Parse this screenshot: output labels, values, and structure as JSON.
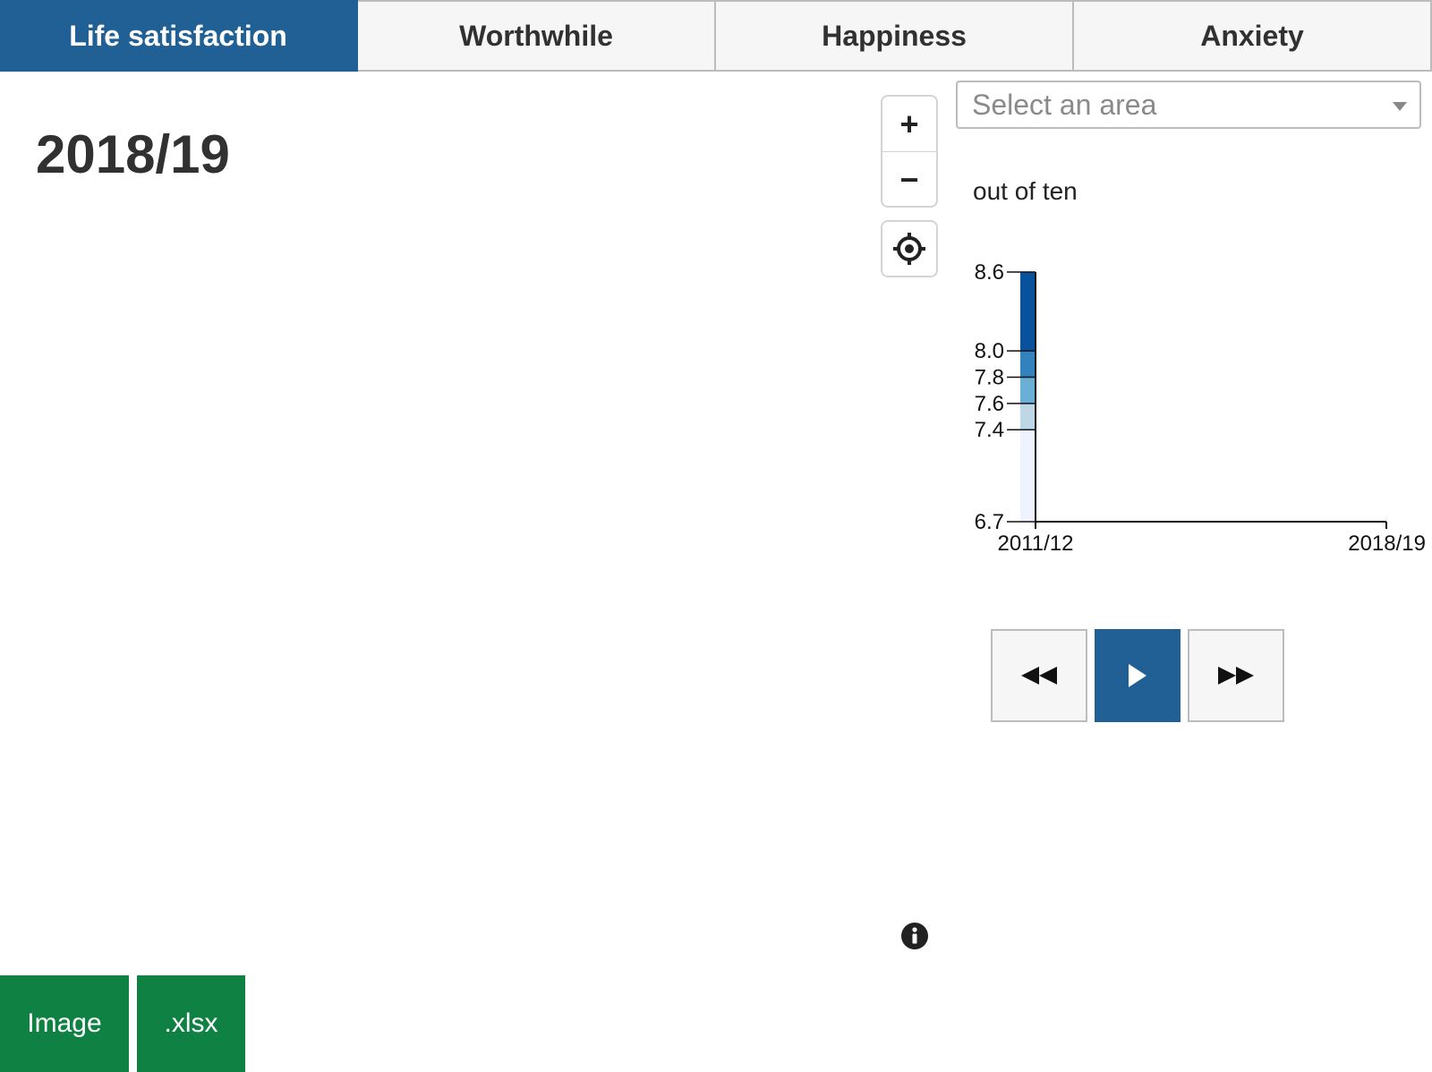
{
  "tabs": [
    {
      "label": "Life satisfaction",
      "active": true
    },
    {
      "label": "Worthwhile",
      "active": false
    },
    {
      "label": "Happiness",
      "active": false
    },
    {
      "label": "Anxiety",
      "active": false
    }
  ],
  "year": "2018/19",
  "map_controls": {
    "zoom_in": "+",
    "zoom_out": "−"
  },
  "area_select": {
    "placeholder": "Select an area"
  },
  "unit_label": "out of ten",
  "legend_colors": {
    "lowest": "#eff3ff",
    "low": "#bdd7e7",
    "mid": "#6baed6",
    "high": "#3182bd",
    "highest": "#08519c"
  },
  "chart_data": {
    "type": "bar",
    "description_role": "choropleth legend / time axis",
    "y_breaks": [
      6.7,
      7.4,
      7.6,
      7.8,
      8.0,
      8.6
    ],
    "ytick_labels": [
      "6.7",
      "7.4",
      "7.6",
      "7.8",
      "8.0",
      "8.6"
    ],
    "ylim": [
      6.7,
      8.6
    ],
    "xtick_labels": [
      "2011/12",
      "2018/19"
    ],
    "bins": [
      {
        "from": 6.7,
        "to": 7.4,
        "color": "#eff3ff"
      },
      {
        "from": 7.4,
        "to": 7.6,
        "color": "#bdd7e7"
      },
      {
        "from": 7.6,
        "to": 7.8,
        "color": "#6baed6"
      },
      {
        "from": 7.8,
        "to": 8.0,
        "color": "#3182bd"
      },
      {
        "from": 8.0,
        "to": 8.6,
        "color": "#08519c"
      }
    ]
  },
  "playback": {
    "accent": "#206095"
  },
  "downloads": {
    "image_label": "Image",
    "xlsx_label": ".xlsx"
  },
  "brand_colors": {
    "primary": "#206095",
    "download": "#0f8243"
  }
}
